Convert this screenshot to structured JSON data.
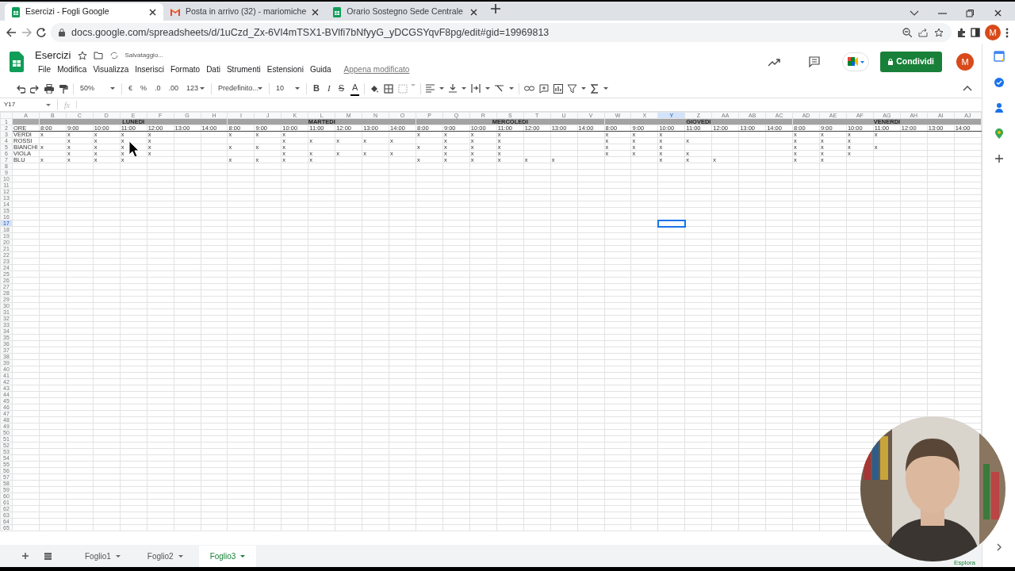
{
  "browser": {
    "tabs": [
      {
        "title": "Esercizi - Fogli Google",
        "kind": "sheets",
        "selected": true
      },
      {
        "title": "Posta in arrivo (32) - mariomiche",
        "kind": "mail",
        "selected": false
      },
      {
        "title": "Orario Sostegno Sede Centrale",
        "kind": "sheets",
        "selected": false
      }
    ],
    "url": "docs.google.com/spreadsheets/d/1uCzd_Zx-6VI4mTSX1-BVlfi7bNfyyG_yDCGSYqvF8pg/edit#gid=19969813",
    "profile": "M"
  },
  "doc": {
    "title": "Esercizi",
    "save_status": "Salvataggio...",
    "menu": [
      "File",
      "Modifica",
      "Visualizza",
      "Inserisci",
      "Formato",
      "Dati",
      "Strumenti",
      "Estensioni",
      "Guida"
    ],
    "last_edit": "Appena modificato",
    "share": "Condividi",
    "account": "M"
  },
  "toolbar": {
    "zoom": "50%",
    "currency": "€",
    "percent": "%",
    "decrease_decimals": ".0",
    "increase_decimals": ".00",
    "number_format": "123",
    "font": "Predefinito...",
    "font_size": "10",
    "styles": [
      {
        "label": "B",
        "kind": "bold"
      },
      {
        "label": "I",
        "kind": "italic"
      },
      {
        "label": "S",
        "kind": "strike"
      },
      {
        "label": "A",
        "kind": "color"
      }
    ]
  },
  "formula_bar": {
    "cell": "Y17",
    "fx": "fx"
  },
  "grid": {
    "columns": [
      {
        "letter": "A",
        "selected": false
      },
      {
        "letter": "B",
        "selected": false
      },
      {
        "letter": "C",
        "selected": false
      },
      {
        "letter": "D",
        "selected": false
      },
      {
        "letter": "E",
        "selected": false
      },
      {
        "letter": "F",
        "selected": false
      },
      {
        "letter": "G",
        "selected": false
      },
      {
        "letter": "H",
        "selected": false
      },
      {
        "letter": "I",
        "selected": false
      },
      {
        "letter": "J",
        "selected": false
      },
      {
        "letter": "K",
        "selected": false
      },
      {
        "letter": "L",
        "selected": false
      },
      {
        "letter": "M",
        "selected": false
      },
      {
        "letter": "N",
        "selected": false
      },
      {
        "letter": "O",
        "selected": false
      },
      {
        "letter": "P",
        "selected": false
      },
      {
        "letter": "Q",
        "selected": false
      },
      {
        "letter": "R",
        "selected": false
      },
      {
        "letter": "S",
        "selected": false
      },
      {
        "letter": "T",
        "selected": false
      },
      {
        "letter": "U",
        "selected": false
      },
      {
        "letter": "V",
        "selected": false
      },
      {
        "letter": "W",
        "selected": false
      },
      {
        "letter": "X",
        "selected": false
      },
      {
        "letter": "Y",
        "selected": true
      },
      {
        "letter": "Z",
        "selected": false
      },
      {
        "letter": "AA",
        "selected": false
      },
      {
        "letter": "AB",
        "selected": false
      },
      {
        "letter": "AC",
        "selected": false
      },
      {
        "letter": "AD",
        "selected": false
      },
      {
        "letter": "AE",
        "selected": false
      },
      {
        "letter": "AF",
        "selected": false
      },
      {
        "letter": "AG",
        "selected": false
      },
      {
        "letter": "AH",
        "selected": false
      },
      {
        "letter": "AI",
        "selected": false
      },
      {
        "letter": "AJ",
        "selected": false
      }
    ],
    "rows": [
      {
        "number": "1",
        "kind": "day_header",
        "selected": false,
        "cells": {
          "B": "LUNEDI",
          "I": "MARTEDI",
          "P": "MERCOLEDI",
          "W": "GIOVEDI",
          "AD": "VENERDI"
        }
      },
      {
        "number": "2",
        "kind": "hours",
        "selected": false,
        "cells": {
          "A": "ORE",
          "B": "8:00",
          "C": "9:00",
          "D": "10:00",
          "E": "11:00",
          "F": "12:00",
          "G": "13:00",
          "H": "14:00",
          "I": "8:00",
          "J": "9:00",
          "K": "10:00",
          "L": "11:00",
          "M": "12:00",
          "N": "13:00",
          "O": "14:00",
          "P": "8:00",
          "Q": "9:00",
          "R": "10:00",
          "S": "11:00",
          "T": "12:00",
          "U": "13:00",
          "V": "14:00",
          "W": "8:00",
          "X": "9:00",
          "Y": "10:00",
          "Z": "11:00",
          "AA": "12:00",
          "AB": "13:00",
          "AC": "14:00",
          "AD": "8:00",
          "AE": "9:00",
          "AF": "10:00",
          "AG": "11:00",
          "AH": "12:00",
          "AI": "13:00",
          "AJ": "14:00"
        }
      },
      {
        "number": "3",
        "kind": "data",
        "selected": false,
        "cells": {
          "A": "VERDI",
          "B": "x",
          "C": "x",
          "D": "x",
          "E": "x",
          "F": "x",
          "I": "x",
          "J": "x",
          "K": "x",
          "P": "x",
          "Q": "x",
          "R": "x",
          "S": "x",
          "W": "x",
          "X": "x",
          "Y": "x",
          "AD": "x",
          "AE": "x",
          "AF": "x",
          "AG": "x"
        }
      },
      {
        "number": "4",
        "kind": "data",
        "selected": false,
        "cells": {
          "A": "ROSSI",
          "C": "x",
          "D": "x",
          "E": "x",
          "F": "x",
          "K": "x",
          "L": "x",
          "M": "x",
          "N": "x",
          "O": "x",
          "Q": "x",
          "R": "x",
          "S": "x",
          "W": "x",
          "X": "x",
          "Y": "x",
          "Z": "x",
          "AD": "x",
          "AE": "x",
          "AF": "x"
        }
      },
      {
        "number": "5",
        "kind": "data",
        "selected": false,
        "cells": {
          "A": "BIANCHI",
          "B": "x",
          "C": "x",
          "D": "x",
          "E": "x",
          "F": "x",
          "I": "x",
          "J": "x",
          "K": "x",
          "P": "x",
          "Q": "x",
          "R": "x",
          "S": "x",
          "W": "x",
          "X": "x",
          "Y": "x",
          "AD": "x",
          "AE": "x",
          "AF": "x",
          "AG": "x"
        }
      },
      {
        "number": "6",
        "kind": "data",
        "selected": false,
        "cells": {
          "A": "VIOLA",
          "C": "x",
          "D": "x",
          "E": "x",
          "F": "x",
          "K": "x",
          "L": "x",
          "M": "x",
          "N": "x",
          "O": "x",
          "Q": "x",
          "R": "x",
          "S": "x",
          "W": "x",
          "X": "x",
          "Y": "x",
          "Z": "x",
          "AD": "x",
          "AE": "x",
          "AF": "x"
        }
      },
      {
        "number": "7",
        "kind": "data",
        "selected": false,
        "cells": {
          "A": "BLU",
          "B": "x",
          "C": "x",
          "D": "x",
          "E": "x",
          "I": "x",
          "J": "x",
          "K": "x",
          "L": "x",
          "P": "x",
          "Q": "x",
          "R": "x",
          "S": "x",
          "T": "x",
          "U": "x",
          "Y": "x",
          "Z": "x",
          "AA": "x",
          "AD": "x",
          "AE": "x"
        }
      },
      {
        "number": "8",
        "kind": "data",
        "selected": false
      },
      {
        "number": "9",
        "kind": "data",
        "selected": false
      },
      {
        "number": "10",
        "kind": "data",
        "selected": false
      },
      {
        "number": "11",
        "kind": "data",
        "selected": false
      },
      {
        "number": "12",
        "kind": "data",
        "selected": false
      },
      {
        "number": "13",
        "kind": "data",
        "selected": false
      },
      {
        "number": "14",
        "kind": "data",
        "selected": false
      },
      {
        "number": "15",
        "kind": "data",
        "selected": false
      },
      {
        "number": "16",
        "kind": "data",
        "selected": false
      },
      {
        "number": "17",
        "kind": "data",
        "selected": true
      },
      {
        "number": "18",
        "kind": "data",
        "selected": false
      },
      {
        "number": "19",
        "kind": "data",
        "selected": false
      },
      {
        "number": "20",
        "kind": "data",
        "selected": false
      },
      {
        "number": "21",
        "kind": "data",
        "selected": false
      },
      {
        "number": "22",
        "kind": "data",
        "selected": false
      },
      {
        "number": "23",
        "kind": "data",
        "selected": false
      },
      {
        "number": "24",
        "kind": "data",
        "selected": false
      },
      {
        "number": "25",
        "kind": "data",
        "selected": false
      },
      {
        "number": "26",
        "kind": "data",
        "selected": false
      },
      {
        "number": "27",
        "kind": "data",
        "selected": false
      },
      {
        "number": "28",
        "kind": "data",
        "selected": false
      },
      {
        "number": "29",
        "kind": "data",
        "selected": false
      },
      {
        "number": "30",
        "kind": "data",
        "selected": false
      },
      {
        "number": "31",
        "kind": "data",
        "selected": false
      },
      {
        "number": "32",
        "kind": "data",
        "selected": false
      },
      {
        "number": "33",
        "kind": "data",
        "selected": false
      },
      {
        "number": "34",
        "kind": "data",
        "selected": false
      },
      {
        "number": "35",
        "kind": "data",
        "selected": false
      },
      {
        "number": "36",
        "kind": "data",
        "selected": false
      },
      {
        "number": "37",
        "kind": "data",
        "selected": false
      },
      {
        "number": "38",
        "kind": "data",
        "selected": false
      },
      {
        "number": "39",
        "kind": "data",
        "selected": false
      },
      {
        "number": "40",
        "kind": "data",
        "selected": false
      },
      {
        "number": "41",
        "kind": "data",
        "selected": false
      },
      {
        "number": "42",
        "kind": "data",
        "selected": false
      },
      {
        "number": "43",
        "kind": "data",
        "selected": false
      },
      {
        "number": "44",
        "kind": "data",
        "selected": false
      },
      {
        "number": "45",
        "kind": "data",
        "selected": false
      },
      {
        "number": "46",
        "kind": "data",
        "selected": false
      },
      {
        "number": "47",
        "kind": "data",
        "selected": false
      },
      {
        "number": "48",
        "kind": "data",
        "selected": false
      },
      {
        "number": "49",
        "kind": "data",
        "selected": false
      },
      {
        "number": "50",
        "kind": "data",
        "selected": false
      },
      {
        "number": "51",
        "kind": "data",
        "selected": false
      },
      {
        "number": "52",
        "kind": "data",
        "selected": false
      },
      {
        "number": "53",
        "kind": "data",
        "selected": false
      },
      {
        "number": "54",
        "kind": "data",
        "selected": false
      },
      {
        "number": "55",
        "kind": "data",
        "selected": false
      },
      {
        "number": "56",
        "kind": "data",
        "selected": false
      },
      {
        "number": "57",
        "kind": "data",
        "selected": false
      },
      {
        "number": "58",
        "kind": "data",
        "selected": false
      },
      {
        "number": "59",
        "kind": "data",
        "selected": false
      },
      {
        "number": "60",
        "kind": "data",
        "selected": false
      },
      {
        "number": "61",
        "kind": "data",
        "selected": false
      },
      {
        "number": "62",
        "kind": "data",
        "selected": false
      },
      {
        "number": "63",
        "kind": "data",
        "selected": false
      },
      {
        "number": "64",
        "kind": "data",
        "selected": false
      },
      {
        "number": "65",
        "kind": "data",
        "selected": false
      }
    ]
  },
  "sheet_tabs": [
    {
      "label": "Foglio1",
      "selected": false
    },
    {
      "label": "Foglio2",
      "selected": false
    },
    {
      "label": "Foglio3",
      "selected": true
    }
  ],
  "explore": "Esplora"
}
